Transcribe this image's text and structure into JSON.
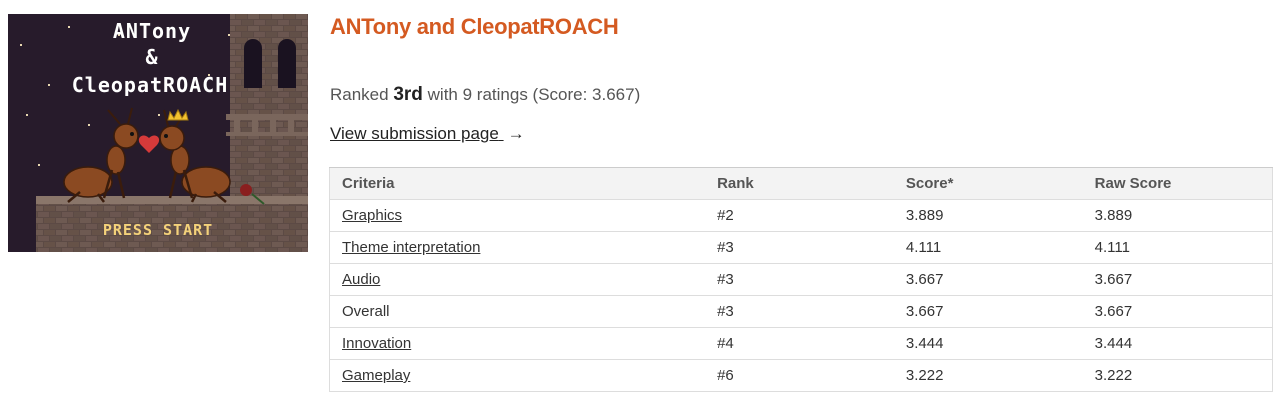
{
  "game": {
    "title": "ANTony and CleopatROACH",
    "thumbnail": {
      "title_line1": "ANTony",
      "title_line2": "&",
      "title_line3": "CleopatROACH",
      "cta": "PRESS START"
    }
  },
  "ranking": {
    "prefix": "Ranked",
    "place": "3rd",
    "suffix": "with 9 ratings (Score: 3.667)"
  },
  "link": {
    "label": "View submission page",
    "arrow": "→"
  },
  "table": {
    "headers": [
      "Criteria",
      "Rank",
      "Score*",
      "Raw Score"
    ],
    "rows": [
      {
        "criteria": "Graphics",
        "rank": "#2",
        "score": "3.889",
        "raw": "3.889",
        "link": true
      },
      {
        "criteria": "Theme interpretation",
        "rank": "#3",
        "score": "4.111",
        "raw": "4.111",
        "link": true
      },
      {
        "criteria": "Audio",
        "rank": "#3",
        "score": "3.667",
        "raw": "3.667",
        "link": true
      },
      {
        "criteria": "Overall",
        "rank": "#3",
        "score": "3.667",
        "raw": "3.667",
        "link": false
      },
      {
        "criteria": "Innovation",
        "rank": "#4",
        "score": "3.444",
        "raw": "3.444",
        "link": true
      },
      {
        "criteria": "Gameplay",
        "rank": "#6",
        "score": "3.222",
        "raw": "3.222",
        "link": true
      }
    ]
  },
  "colors": {
    "title": "#d45a21",
    "thumbnail_bg": "#271b2b",
    "press_start": "#f4d27a",
    "heart": "#d63a3a",
    "crown": "#f2c230"
  }
}
